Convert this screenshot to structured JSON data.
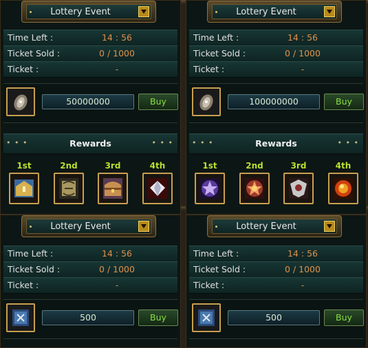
{
  "panels": [
    {
      "title": "Lottery Event",
      "time_left_label": "Time Left :",
      "time_left": "14 : 56",
      "ticket_sold_label": "Ticket Sold :",
      "ticket_sold": "0 / 1000",
      "ticket_label": "Ticket :",
      "ticket": "-",
      "ticket_item_icon": "scroll-icon",
      "price": "50000000",
      "buy_label": "Buy",
      "rewards_title": "Rewards",
      "rewards_dots": "• • •",
      "rewards": [
        {
          "rank": "1st",
          "icon": "golden-chest-icon"
        },
        {
          "rank": "2nd",
          "icon": "ornate-box-icon"
        },
        {
          "rank": "3rd",
          "icon": "treasure-chest-icon"
        },
        {
          "rank": "4th",
          "icon": "diamond-icon"
        }
      ]
    },
    {
      "title": "Lottery Event",
      "time_left_label": "Time Left :",
      "time_left": "14 : 56",
      "ticket_sold_label": "Ticket Sold :",
      "ticket_sold": "0 / 1000",
      "ticket_label": "Ticket :",
      "ticket": "-",
      "ticket_item_icon": "scroll-icon",
      "price": "100000000",
      "buy_label": "Buy",
      "rewards_title": "Rewards",
      "rewards_dots": "• • •",
      "rewards": [
        {
          "rank": "1st",
          "icon": "purple-star-emblem-icon"
        },
        {
          "rank": "2nd",
          "icon": "red-star-emblem-icon"
        },
        {
          "rank": "3rd",
          "icon": "silver-crest-icon"
        },
        {
          "rank": "4th",
          "icon": "fire-orb-icon"
        }
      ]
    },
    {
      "title": "Lottery Event",
      "time_left_label": "Time Left :",
      "time_left": "14 : 56",
      "ticket_sold_label": "Ticket Sold :",
      "ticket_sold": "0 / 1000",
      "ticket_label": "Ticket :",
      "ticket": "-",
      "ticket_item_icon": "spellbook-icon",
      "price": "500",
      "buy_label": "Buy"
    },
    {
      "title": "Lottery Event",
      "time_left_label": "Time Left :",
      "time_left": "14 : 56",
      "ticket_sold_label": "Ticket Sold :",
      "ticket_sold": "0 / 1000",
      "ticket_label": "Ticket :",
      "ticket": "-",
      "ticket_item_icon": "spellbook-icon",
      "price": "500",
      "buy_label": "Buy"
    }
  ],
  "colors": {
    "label": "#e0e0e0",
    "value": "#e0904a",
    "rank": "#b8e030",
    "buy": "#8ae040",
    "frame_gold": "#c8a050"
  }
}
